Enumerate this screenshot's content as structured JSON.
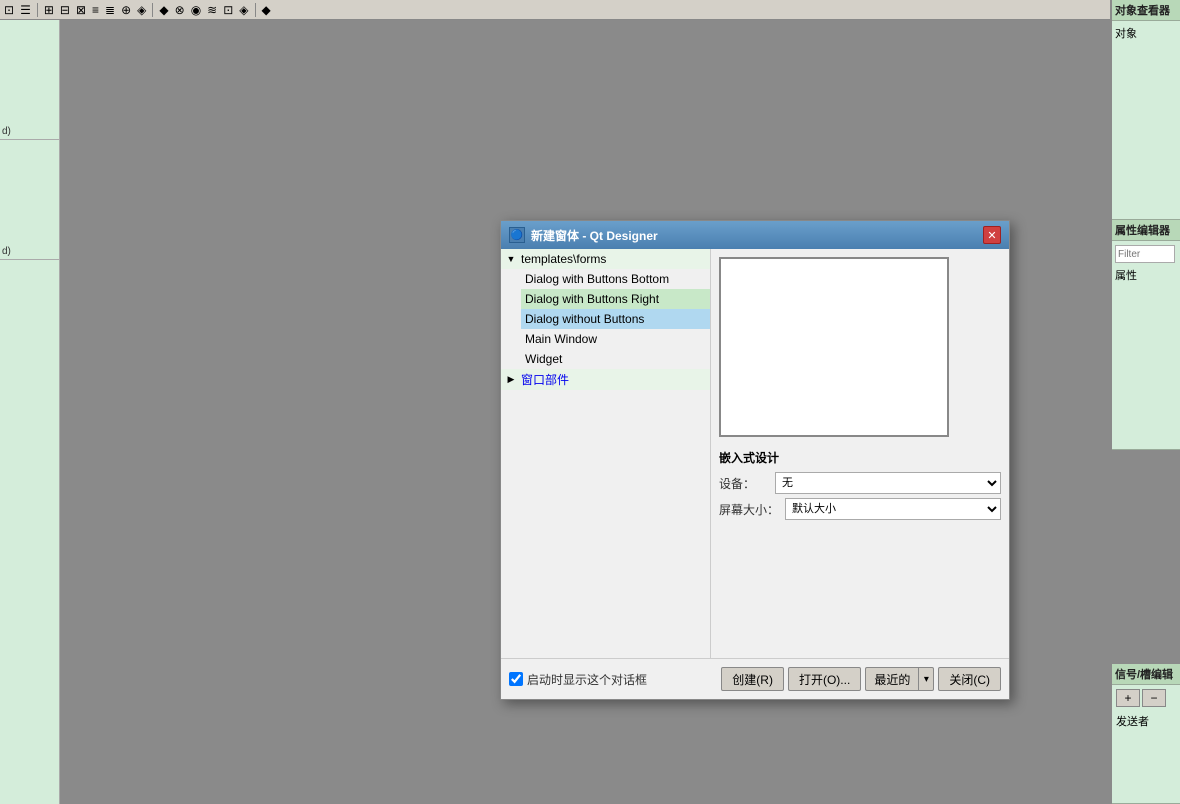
{
  "toolbar": {
    "icons": [
      "⊡",
      "☰",
      "⊞",
      "⊟",
      "⊠",
      "≡",
      "≣",
      "⊕",
      "◈",
      "⊗",
      "◉",
      "≋",
      "≣",
      "⊞",
      "◆",
      "⊡",
      "◈"
    ]
  },
  "left_panel": {
    "items": [
      {
        "label": "d)"
      },
      {
        "label": "d)"
      }
    ]
  },
  "right_panels": {
    "object_inspector": {
      "title": "对象查看器",
      "label": "对象"
    },
    "property_editor": {
      "title": "属性编辑器",
      "filter_placeholder": "Filter",
      "label": "属性"
    },
    "signal_editor": {
      "title": "信号/槽编辑",
      "add_label": "+",
      "remove_label": "−",
      "sender_label": "发送者"
    }
  },
  "dialog": {
    "title": "新建窗体 - Qt Designer",
    "icon": "🔵",
    "close_button": "✕",
    "tree": {
      "root": {
        "label": "templates\\forms",
        "expanded": true,
        "children": [
          {
            "label": "Dialog with Buttons Bottom",
            "selected": false
          },
          {
            "label": "Dialog with Buttons Right",
            "selected": false
          },
          {
            "label": "Dialog without Buttons",
            "selected": true
          },
          {
            "label": "Main Window",
            "selected": false
          },
          {
            "label": "Widget",
            "selected": false
          }
        ]
      },
      "second": {
        "label": "窗口部件",
        "expanded": false,
        "children": []
      }
    },
    "embedded_design": {
      "title": "嵌入式设计",
      "device_label": "设备：",
      "device_value": "无",
      "screen_label": "屏幕大小：",
      "screen_value": "默认大小"
    },
    "footer": {
      "checkbox_checked": true,
      "checkbox_label": "启动时显示这个对话框",
      "buttons": {
        "create": "创建(R)",
        "open": "打开(O)...",
        "recent": "最近的",
        "close": "关闭(C)"
      }
    }
  }
}
